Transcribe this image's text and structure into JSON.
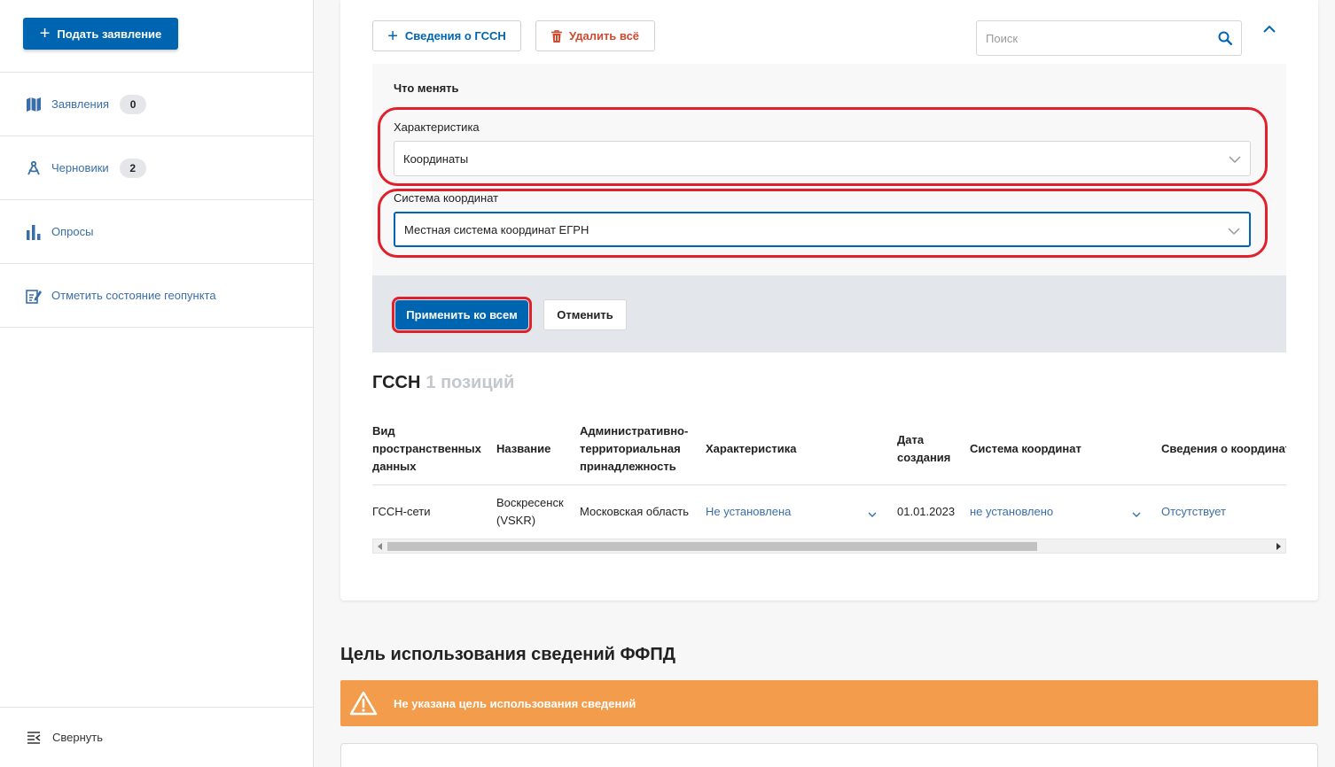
{
  "sidebar": {
    "submit_label": "Подать заявление",
    "items": [
      {
        "label": "Заявления",
        "badge": "0",
        "icon": "map-icon"
      },
      {
        "label": "Черновики",
        "badge": "2",
        "icon": "compass-icon"
      },
      {
        "label": "Опросы",
        "icon": "bar-chart-icon"
      },
      {
        "label": "Отметить состояние геопункта",
        "icon": "edit-note-icon"
      }
    ],
    "collapse_label": "Свернуть"
  },
  "toolbar": {
    "add_gssn_label": "Сведения о ГССН",
    "delete_all_label": "Удалить всё",
    "search_placeholder": "Поиск"
  },
  "change_panel": {
    "title": "Что менять",
    "characteristic_label": "Характеристика",
    "characteristic_value": "Координаты",
    "coord_system_label": "Система координат",
    "coord_system_value": "Местная система координат ЕГРН",
    "apply_label": "Применить ко всем",
    "cancel_label": "Отменить"
  },
  "gssn": {
    "title": "ГССН",
    "count": "1 позиций",
    "columns": {
      "type": "Вид\nпространственных\nданных",
      "name": "Название",
      "admin": "Административно-\nтерриториальная\nпринадлежность",
      "characteristic": "Характеристика",
      "created": "Дата\nсоздания",
      "coord_system": "Система координат",
      "coord_info": "Сведения о координатах"
    },
    "rows": [
      {
        "type": "ГССН-сети",
        "name": "Воскресенск\n(VSKR)",
        "admin": "Московская область",
        "characteristic": "Не установлена",
        "created": "01.01.2023",
        "coord_system": "не установлено",
        "coord_info": "Отсутствует"
      }
    ]
  },
  "purpose": {
    "title": "Цель использования сведений ФФПД",
    "warning": "Не указана цель использования сведений"
  },
  "colors": {
    "primary": "#0065b1",
    "link": "#3a6ea8",
    "danger": "#d04a2f",
    "highlight": "#e0202a",
    "warning_bg": "#f29c4c"
  }
}
